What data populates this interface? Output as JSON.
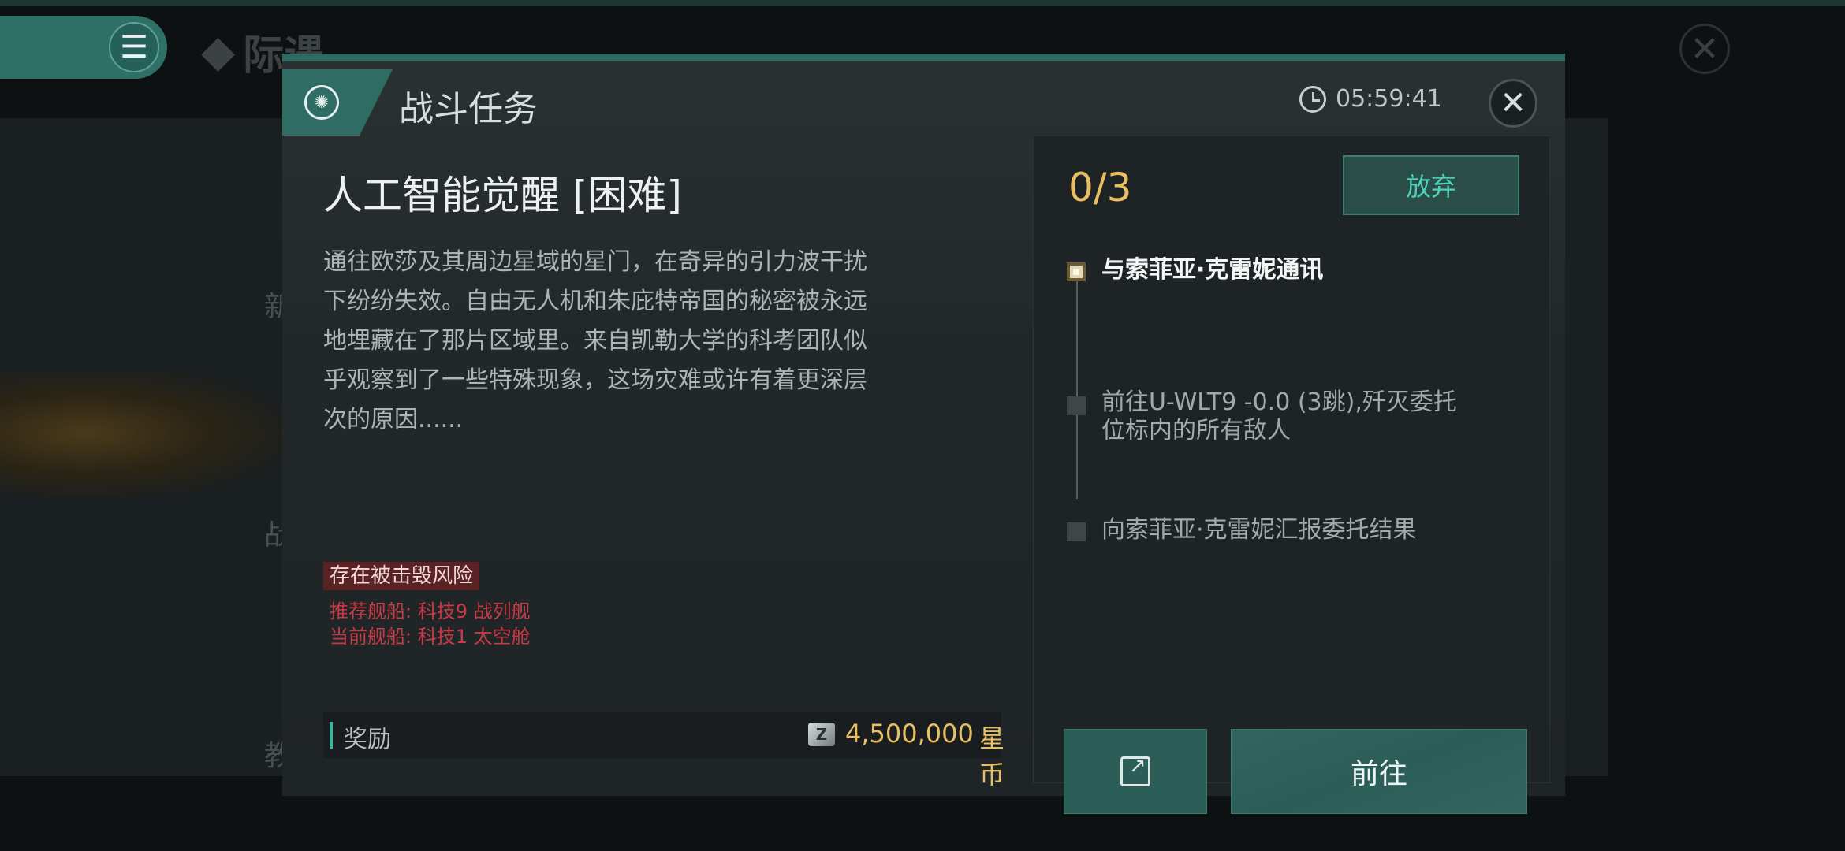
{
  "background": {
    "brand_text": "际遇",
    "menu_icon": "☰",
    "close_icon": "✕",
    "ghost_labels": [
      "新",
      "战",
      "教"
    ]
  },
  "dialog": {
    "title": "战斗任务",
    "timer": "05:59:41",
    "close_icon": "✕",
    "mission_name": "人工智能觉醒 [困难]",
    "description": "通往欧莎及其周边星域的星门，在奇异的引力波干扰下纷纷失效。自由无人机和朱庇特帝国的秘密被永远地埋藏在了那片区域里。来自凯勒大学的科考团队似乎观察到了一些特殊现象，这场灾难或许有着更深层次的原因......",
    "risk_badge": "存在被击毁风险",
    "recommended_ship": "推荐舰船: 科技9 战列舰",
    "current_ship": "当前舰船: 科技1 太空舱",
    "reward": {
      "label": "奖励",
      "amount": "4,500,000",
      "unit": "星币"
    },
    "progress": "0/3",
    "abandon_label": "放弃",
    "steps": [
      {
        "text": "与索菲亚·克雷妮通讯",
        "active": true
      },
      {
        "text": "前往U-WLT9 -0.0 (3跳),歼灭委托位标内的所有敌人",
        "active": false
      },
      {
        "text": "向索菲亚·克雷妮汇报委托结果",
        "active": false
      }
    ],
    "go_label": "前往"
  },
  "colors": {
    "accent_teal": "#2f6d64",
    "gold": "#e8bf62",
    "danger_red": "#c83a45"
  }
}
